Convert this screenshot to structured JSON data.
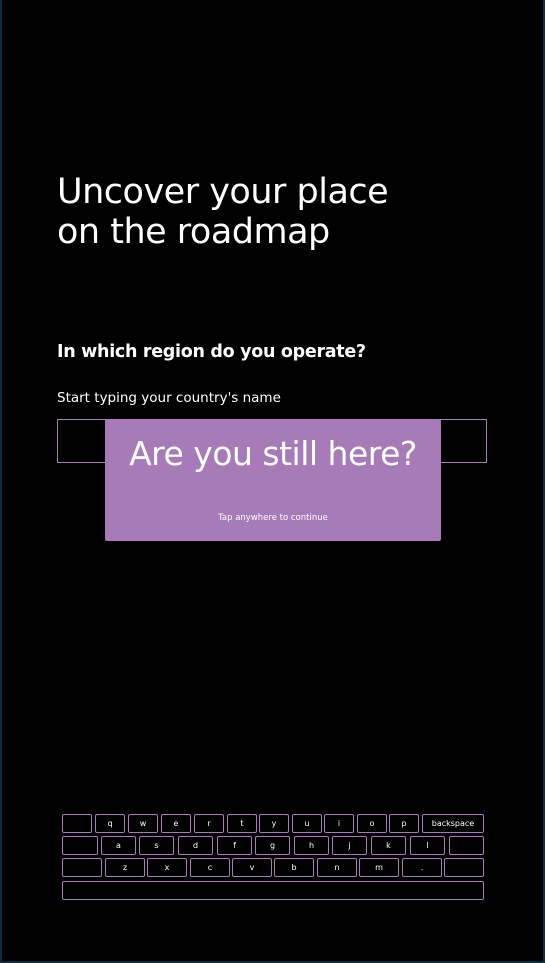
{
  "page": {
    "headline_line1": "Uncover your place",
    "headline_line2": "on the roadmap",
    "question": "In which region do you operate?",
    "hint": "Start typing your country's name",
    "country_input": {
      "value": "",
      "placeholder": ""
    }
  },
  "modal": {
    "title": "Are you still here?",
    "subtitle": "Tap anywhere to continue"
  },
  "keyboard": {
    "row1": [
      "",
      "q",
      "w",
      "e",
      "r",
      "t",
      "y",
      "u",
      "i",
      "o",
      "p",
      "backspace"
    ],
    "row2": [
      "",
      "a",
      "s",
      "d",
      "f",
      "g",
      "h",
      "j",
      "k",
      "l",
      ""
    ],
    "row3": [
      "",
      "z",
      "x",
      "c",
      "v",
      "b",
      "n",
      "m",
      ".",
      ""
    ],
    "space": ""
  },
  "colors": {
    "background": "#000000",
    "accent": "#a77ab8",
    "outer_frame": "#0e2a3f",
    "text": "#ffffff"
  }
}
